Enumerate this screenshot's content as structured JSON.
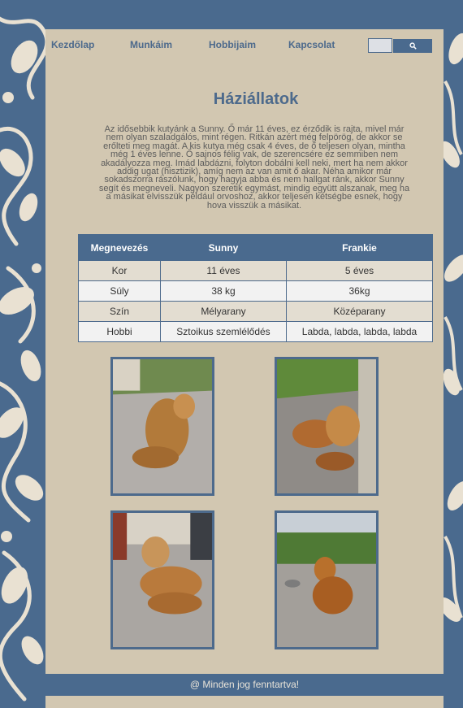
{
  "nav": {
    "items": [
      {
        "label": "Kezdőlap"
      },
      {
        "label": "Munkáim"
      },
      {
        "label": "Hobbijaim"
      },
      {
        "label": "Kapcsolat"
      }
    ]
  },
  "search": {
    "placeholder": "",
    "button_icon": "search-icon"
  },
  "main": {
    "title": "Háziállatok",
    "intro": "Az idősebbik kutyánk a Sunny. Ő már 11 éves, ez érződik is rajta, mivel már nem olyan szaladgálós, mint régen. Ritkán azért még felpörög, de akkor se erőlteti meg magát. A kis kutya még csak 4 éves, de ő teljesen olyan, mintha még 1 éves lenne. Ő sajnos félig vak, de szerencsére ez semmiben nem akadályozza meg. Imád labdázni, folyton dobálni kell neki, mert ha nem akkor addig ugat (hisztizik), amíg nem az van amit ő akar. Néha amikor már sokadszorra rászólunk, hogy hagyja abba és nem hallgat ránk, akkor Sunny segít és megneveli. Nagyon szeretik egymást, mindig együtt alszanak, meg ha a másikat elvisszük például orvoshoz, akkor teljesen kétségbe esnek, hogy hova visszük a másikat."
  },
  "table": {
    "headers": [
      "Megnevezés",
      "Sunny",
      "Frankie"
    ],
    "rows": [
      [
        "Kor",
        "11 éves",
        "5 éves"
      ],
      [
        "Súly",
        "38 kg",
        "36kg"
      ],
      [
        "Szín",
        "Mélyarany",
        "Középarany"
      ],
      [
        "Hobbi",
        "Sztoikus szemlélődés",
        "Labda, labda, labda, labda"
      ]
    ]
  },
  "photos": [
    {
      "name": "dog-photo-1"
    },
    {
      "name": "dog-photo-2"
    },
    {
      "name": "dog-photo-3"
    },
    {
      "name": "dog-photo-4"
    }
  ],
  "footer": {
    "text": "@ Minden jog fenntartva!"
  },
  "colors": {
    "accent": "#4a6a8e",
    "page_background": "#d2c7b1",
    "nav_text": "#4d6a8c"
  }
}
